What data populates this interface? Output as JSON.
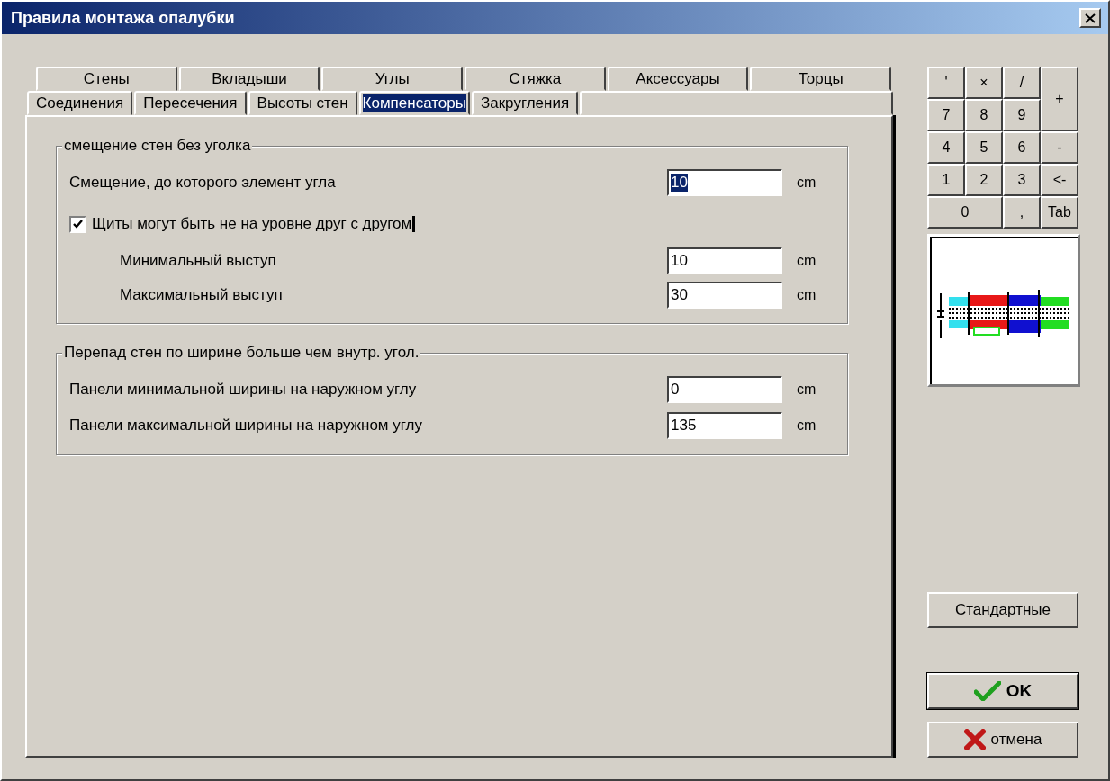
{
  "window": {
    "title": "Правила монтажа опалубки"
  },
  "tabs": {
    "back_row": [
      {
        "label": "Стены",
        "selected": false
      },
      {
        "label": "Вкладыши",
        "selected": false
      },
      {
        "label": "Углы",
        "selected": false
      },
      {
        "label": "Стяжка",
        "selected": false
      },
      {
        "label": "Аксессуары",
        "selected": false
      },
      {
        "label": "Торцы",
        "selected": false
      }
    ],
    "front_row": [
      {
        "label": "Соединения",
        "selected": false
      },
      {
        "label": "Пересечения",
        "selected": false
      },
      {
        "label": "Высоты стен",
        "selected": false
      },
      {
        "label": "Компенсаторы",
        "selected": true
      },
      {
        "label": "Закругления",
        "selected": false
      }
    ]
  },
  "groups": [
    {
      "title": "смещение стен без уголка",
      "items": [
        {
          "kind": "field",
          "label": "Смещение, до которого элемент угла",
          "value": "10",
          "unit": "cm",
          "focused": true
        },
        {
          "kind": "checkbox",
          "label": "Щиты могут быть не на уровне друг с другом",
          "checked": true
        },
        {
          "kind": "subfield",
          "label": "Минимальный выступ",
          "value": "10",
          "unit": "cm",
          "focused": false
        },
        {
          "kind": "subfield",
          "label": "Максимальный выступ",
          "value": "30",
          "unit": "cm",
          "focused": false
        }
      ]
    },
    {
      "title": "Перепад стен по ширине больше чем внутр. угол.",
      "items": [
        {
          "kind": "field",
          "label": "Панели минимальной ширины на наружном углу",
          "value": "0",
          "unit": "cm",
          "focused": false
        },
        {
          "kind": "field",
          "label": "Панели максимальной ширины на наружном углу",
          "value": "135",
          "unit": "cm",
          "focused": false
        }
      ]
    }
  ],
  "keypad": [
    "'",
    "×",
    "/",
    "+",
    "7",
    "8",
    "9",
    "4",
    "5",
    "6",
    "-",
    "1",
    "2",
    "3",
    "<-",
    "0",
    ",",
    "Tab"
  ],
  "buttons": [
    {
      "kind": "plain",
      "label": "Стандартные"
    },
    {
      "kind": "ok",
      "label": "OK"
    },
    {
      "kind": "cancel",
      "label": "отмена"
    }
  ]
}
